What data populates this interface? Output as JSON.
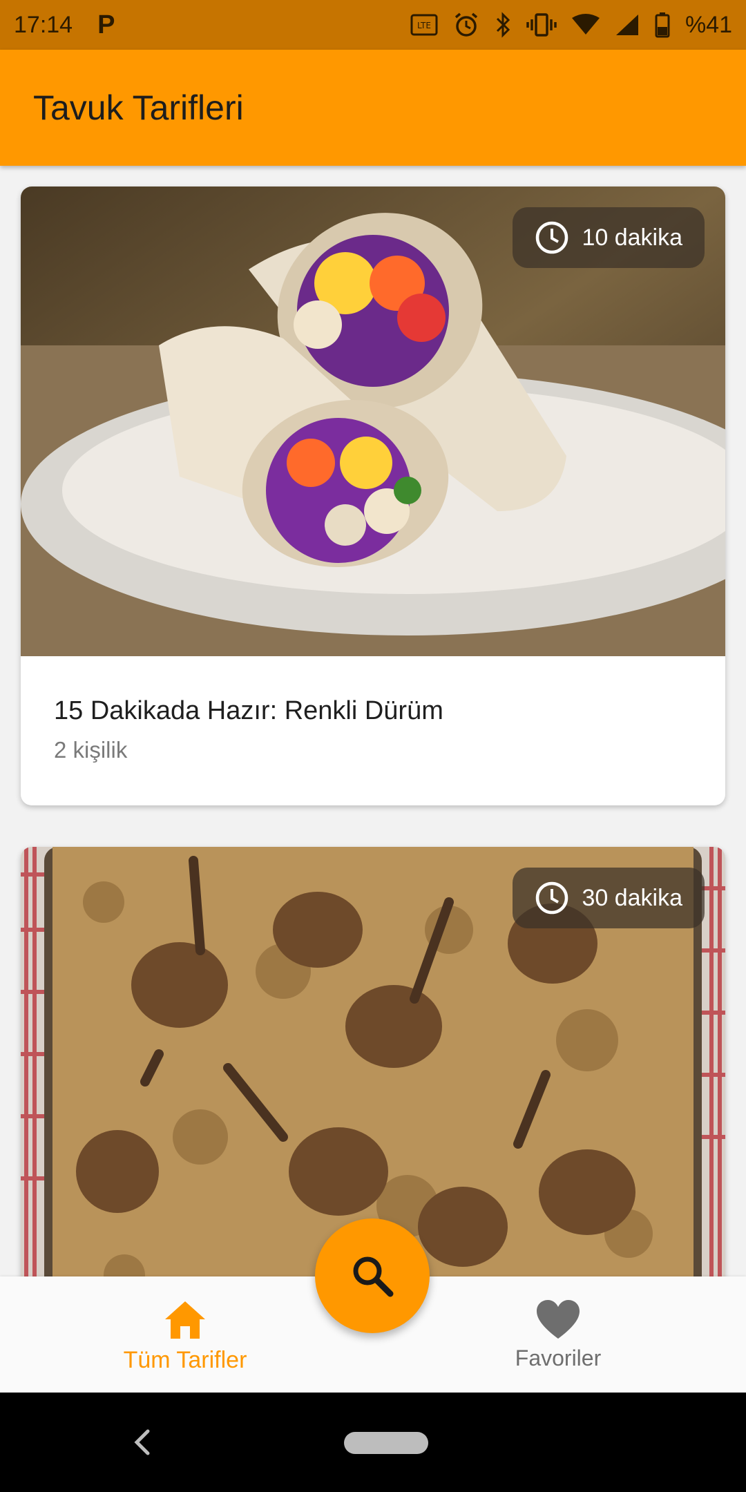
{
  "status_bar": {
    "time": "17:14",
    "notification_icon": "parking-p-icon",
    "icons": [
      "volte-icon",
      "alarm-icon",
      "bluetooth-icon",
      "vibrate-icon",
      "wifi-icon",
      "signal-icon",
      "battery-icon"
    ],
    "battery": "%41"
  },
  "app_bar": {
    "title": "Tavuk Tarifleri"
  },
  "recipes": [
    {
      "duration": "10 dakika",
      "title": "15 Dakikada Hazır: Renkli Dürüm",
      "servings": "2 kişilik",
      "image": "chicken-wrap-photo"
    },
    {
      "duration": "30 dakika",
      "image": "chicken-drumsticks-rice-photo"
    }
  ],
  "bottom_nav": {
    "items": [
      {
        "label": "Tüm Tarifler",
        "icon": "home-icon",
        "active": true
      },
      {
        "label": "Favoriler",
        "icon": "heart-icon",
        "active": false
      }
    ],
    "fab_icon": "search-icon"
  },
  "colors": {
    "accent": "#ff9800",
    "status_bar": "#c67400",
    "inactive": "#6e6e6e"
  },
  "system_nav": {
    "back_icon": "back-chevron-icon",
    "home_icon": "home-pill-icon"
  }
}
